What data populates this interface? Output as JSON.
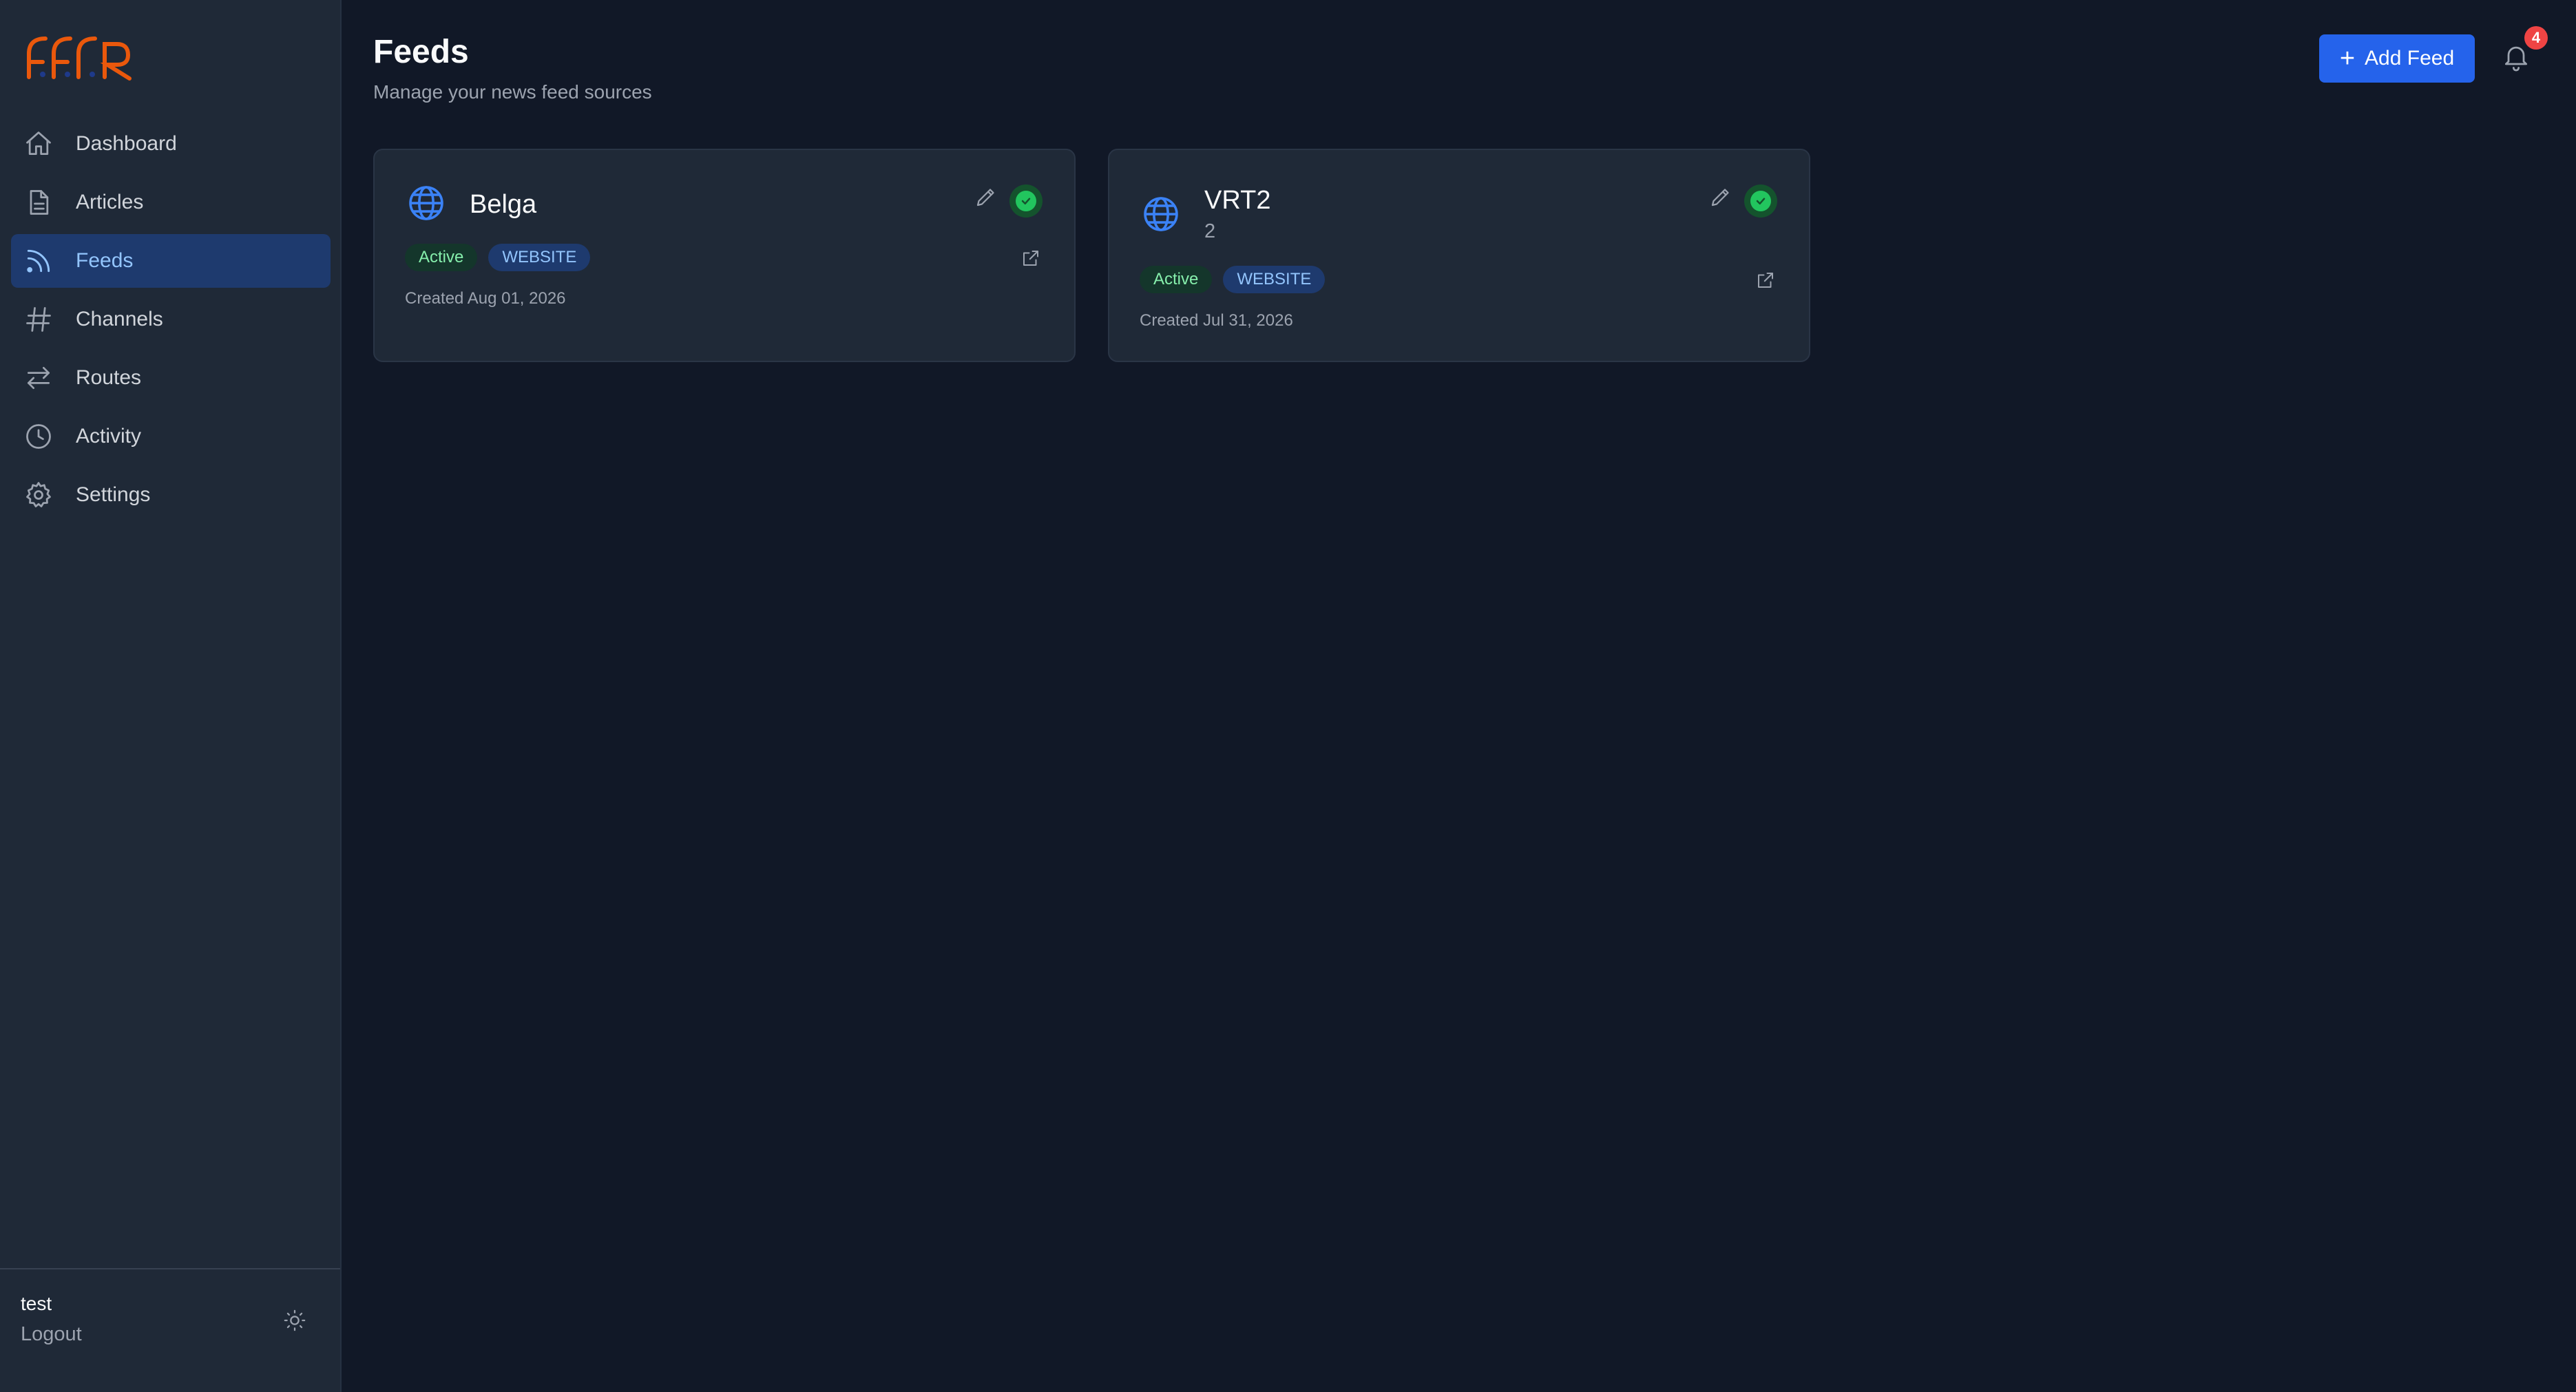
{
  "sidebar": {
    "logo_text": "FFR",
    "items": [
      {
        "label": "Dashboard",
        "icon": "home-icon"
      },
      {
        "label": "Articles",
        "icon": "document-icon"
      },
      {
        "label": "Feeds",
        "icon": "rss-icon",
        "active": true
      },
      {
        "label": "Channels",
        "icon": "hash-icon"
      },
      {
        "label": "Routes",
        "icon": "arrows-exchange-icon"
      },
      {
        "label": "Activity",
        "icon": "clock-icon"
      },
      {
        "label": "Settings",
        "icon": "gear-icon"
      }
    ],
    "user": "test",
    "logout_label": "Logout",
    "theme_icon": "sun-icon"
  },
  "header": {
    "title": "Feeds",
    "subtitle": "Manage your news feed sources",
    "add_button_label": "Add Feed",
    "notification_count": "4"
  },
  "feeds": [
    {
      "name": "Belga",
      "subtitle": "",
      "status": "Active",
      "type": "WEBSITE",
      "created": "Created Aug 01, 2026"
    },
    {
      "name": "VRT2",
      "subtitle": "2",
      "status": "Active",
      "type": "WEBSITE",
      "created": "Created Jul 31, 2026"
    }
  ],
  "colors": {
    "background": "#111827",
    "sidebar": "#1f2937",
    "accent": "#2563eb",
    "active_nav_bg": "#1e3a6e",
    "active_nav_text": "#93c5fd",
    "status_green": "#22c55e",
    "notification_red": "#ef4444",
    "logo_orange": "#ea580c"
  }
}
